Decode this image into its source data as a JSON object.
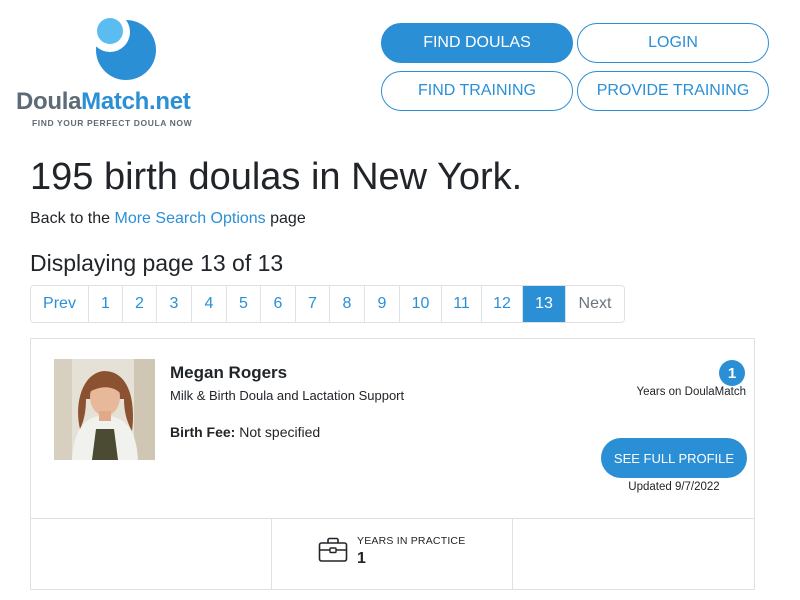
{
  "header": {
    "logo_text_part1": "Doula",
    "logo_text_part2": "Match.net",
    "tagline": "FIND YOUR PERFECT DOULA NOW",
    "nav": {
      "find_doulas": "FIND DOULAS",
      "login": "LOGIN",
      "find_training": "FIND TRAINING",
      "provide_training": "PROVIDE TRAINING"
    }
  },
  "main": {
    "title": "195 birth doulas in New York.",
    "back_prefix": "Back to the ",
    "back_link": "More Search Options",
    "back_suffix": " page",
    "displaying": "Displaying page 13 of 13"
  },
  "pagination": {
    "prev": "Prev",
    "pages": [
      "1",
      "2",
      "3",
      "4",
      "5",
      "6",
      "7",
      "8",
      "9",
      "10",
      "11",
      "12",
      "13"
    ],
    "active_page": "13",
    "next": "Next"
  },
  "card": {
    "name": "Megan Rogers",
    "subtitle": "Milk & Birth Doula and Lactation Support",
    "fee_label": "Birth Fee:",
    "fee_value": " Not specified",
    "years_on_site": "1",
    "years_on_site_label": "Years on DoulaMatch",
    "profile_button": "SEE FULL PROFILE",
    "updated": "Updated 9/7/2022",
    "stats": {
      "years_in_practice_label": "YEARS IN PRACTICE",
      "years_in_practice_value": "1",
      "icon": "briefcase-icon"
    }
  },
  "colors": {
    "accent": "#2b8fd6",
    "logo_gray": "#5c6b77",
    "border": "#dee2e6"
  }
}
